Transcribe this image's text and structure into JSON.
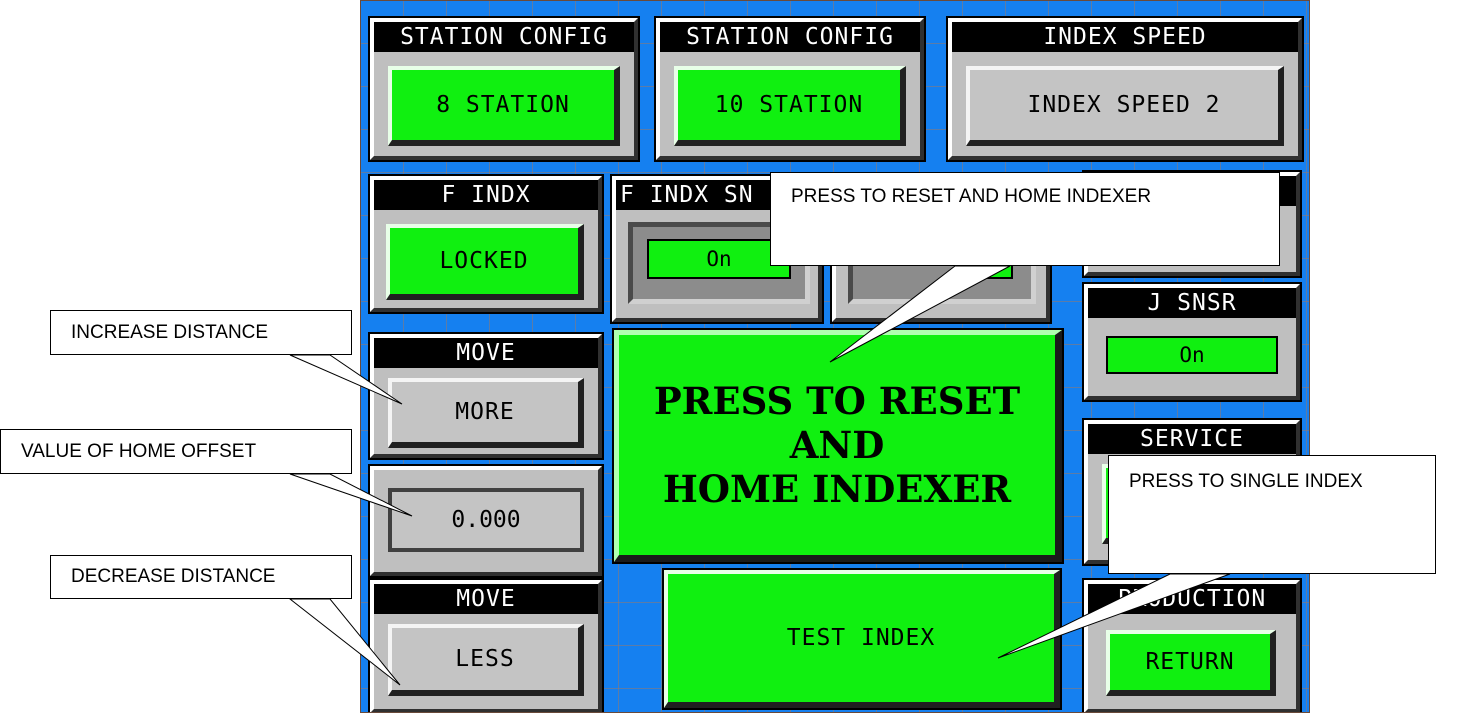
{
  "hmi": {
    "station_config_8": {
      "header": "STATION CONFIG",
      "label": "8 STATION"
    },
    "station_config_10": {
      "header": "STATION CONFIG",
      "label": "10 STATION"
    },
    "index_speed": {
      "header": "INDEX SPEED",
      "label": "INDEX SPEED 2"
    },
    "f_indx": {
      "header": "F INDX",
      "label": "LOCKED"
    },
    "f_indx_sn": {
      "header": "F INDX SN",
      "value": "On"
    },
    "j_snsr": {
      "header": "J SNSR",
      "value": "On"
    },
    "move_more": {
      "header": "MOVE",
      "label": "MORE"
    },
    "home_offset": {
      "value": "0.000"
    },
    "move_less": {
      "header": "MOVE",
      "label": "LESS"
    },
    "reset_home": {
      "label_line1": "PRESS TO RESET AND",
      "label_line2": "HOME INDEXER"
    },
    "test_index": {
      "label": "TEST INDEX"
    },
    "service": {
      "header": "SERVICE"
    },
    "production": {
      "header": "PRODUCTION",
      "label": "RETURN"
    }
  },
  "callouts": {
    "increase_distance": "INCREASE DISTANCE",
    "value_home_offset": "VALUE OF HOME OFFSET",
    "decrease_distance": "DECREASE DISTANCE",
    "reset_home_indexer": "PRESS TO RESET AND HOME INDEXER",
    "single_index": "PRESS TO SINGLE INDEX"
  },
  "colors": {
    "background": "#1580f0",
    "active_green": "#10f010",
    "inactive_grey": "#c4c4c4",
    "header_black": "#000000"
  }
}
